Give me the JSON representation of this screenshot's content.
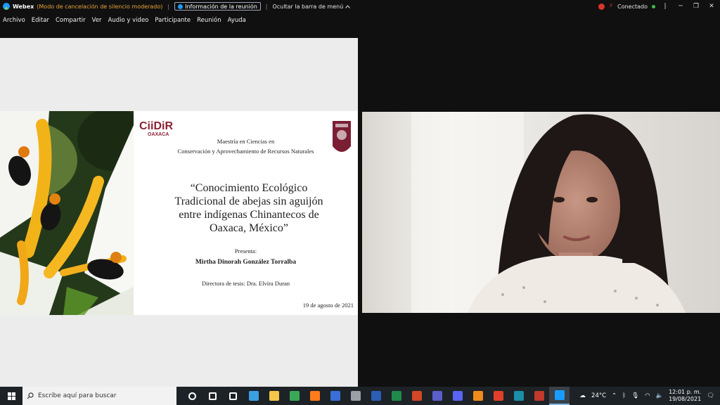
{
  "titlebar": {
    "app_name": "Webex",
    "mode_text": "(Modo de cancelación de silencio moderado)",
    "separator": "|",
    "meeting_info": "Información de la reunión",
    "hide_menu": "Ocultar la barra de menú",
    "status": "Conectado"
  },
  "menu": [
    "Archivo",
    "Editar",
    "Compartir",
    "Ver",
    "Audio y video",
    "Participante",
    "Reunión",
    "Ayuda"
  ],
  "slide": {
    "institution_logo": "CIIDIR OAXACA",
    "program_line1": "Maestría en Ciencias en",
    "program_line2": "Conservación y Aprovechamiento de Recursos Naturales",
    "title_lines": [
      "“Conocimiento Ecológico",
      "Tradicional de abejas sin aguijón",
      "entre indígenas Chinantecos de",
      "Oaxaca, México”"
    ],
    "presenta": "Presenta:",
    "presenter": "Mirtha Dinorah González Torralba",
    "director": "Directora de tesis: Dra. Elvira Duran",
    "date": "19 de agosto de 2021"
  },
  "taskbar": {
    "search_placeholder": "Escribe aquí para buscar",
    "apps": [
      {
        "name": "cortana-icon",
        "color": "#ffffff"
      },
      {
        "name": "task-view-icon",
        "color": "#ffffff"
      },
      {
        "name": "settings-icon",
        "color": "#ffffff"
      },
      {
        "name": "remote-desktop-icon",
        "color": "#3aa0e0"
      },
      {
        "name": "file-explorer-icon",
        "color": "#f3c64a"
      },
      {
        "name": "chrome-icon",
        "color": "#3aa757"
      },
      {
        "name": "firefox-icon",
        "color": "#ff7b1c"
      },
      {
        "name": "cap-app-icon",
        "color": "#3a6fd8"
      },
      {
        "name": "calculator-icon",
        "color": "#9aa0a6"
      },
      {
        "name": "word-icon",
        "color": "#2b5fb4"
      },
      {
        "name": "excel-icon",
        "color": "#1f8a4c"
      },
      {
        "name": "powerpoint-icon",
        "color": "#d24726"
      },
      {
        "name": "teams-icon",
        "color": "#5b5fc7"
      },
      {
        "name": "discord-icon",
        "color": "#5865f2"
      },
      {
        "name": "vlc-icon",
        "color": "#f08a1c"
      },
      {
        "name": "app-red-icon",
        "color": "#e0402a"
      },
      {
        "name": "app-teal-icon",
        "color": "#1b8fa8"
      },
      {
        "name": "app-dark-icon",
        "color": "#c0392b"
      },
      {
        "name": "webex-icon",
        "color": "#1a9cff"
      }
    ],
    "temperature": "24°C",
    "time": "12:01 p. m.",
    "date": "19/08/2021"
  }
}
